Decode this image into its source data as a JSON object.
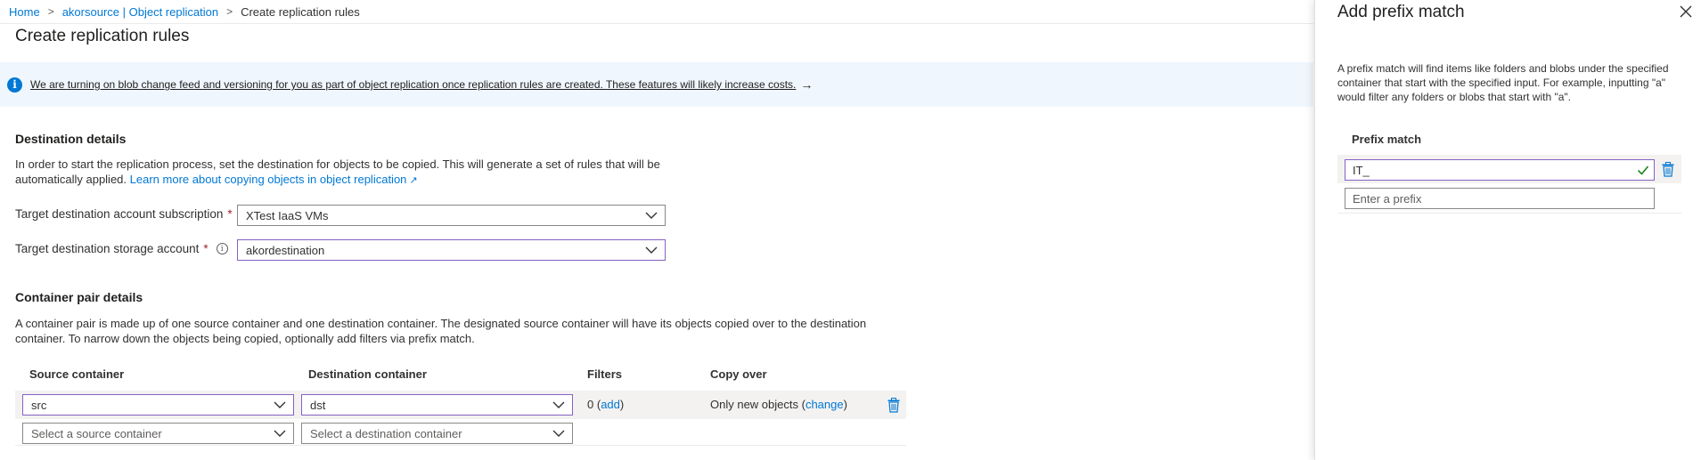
{
  "breadcrumb": {
    "home": "Home",
    "parent": "akorsource | Object replication",
    "current": "Create replication rules",
    "separator": ">"
  },
  "page": {
    "title": "Create replication rules"
  },
  "banner": {
    "icon": "info-icon",
    "text": "We are turning on blob change feed and versioning for you as part of object replication once replication rules are created. These features will likely increase costs.",
    "arrow": "→"
  },
  "destination": {
    "title": "Destination details",
    "description": "In order to start the replication process, set the destination for objects to be copied. This will generate a set of rules that will be automatically applied.",
    "learn_more": "Learn more about copying objects in object replication",
    "subscription_label": "Target destination account subscription",
    "subscription_value": "XTest IaaS VMs",
    "storage_label": "Target destination storage account",
    "storage_value": "akordestination",
    "required_mark": "*",
    "info_glyph": "i"
  },
  "container_pairs": {
    "title": "Container pair details",
    "description": "A container pair is made up of one source container and one destination container. The designated source container will have its objects copied over to the destination container. To narrow down the objects being copied, optionally add filters via prefix match.",
    "columns": [
      "Source container",
      "Destination container",
      "Filters",
      "Copy over"
    ],
    "rows": [
      {
        "source": "src",
        "destination": "dst",
        "filters_count": "0",
        "filters_action": "add",
        "copy_over": "Only new objects",
        "copy_over_action": "change"
      }
    ],
    "new_row": {
      "source_placeholder": "Select a source container",
      "destination_placeholder": "Select a destination container"
    }
  },
  "panel": {
    "title": "Add prefix match",
    "description": "A prefix match will find items like folders and blobs under the specified container that start with the specified input. For example, inputting \"a\" would filter any folders or blobs that start with \"a\".",
    "column": "Prefix match",
    "prefixes": [
      "IT_"
    ],
    "new_prefix_placeholder": "Enter a prefix"
  },
  "colors": {
    "accent": "#0078d4",
    "focus_border": "#8661c5",
    "required": "#a4262c",
    "valid_check": "#107c10",
    "banner_bg": "#f0f6fd",
    "row_highlight": "#f3f2f1"
  }
}
